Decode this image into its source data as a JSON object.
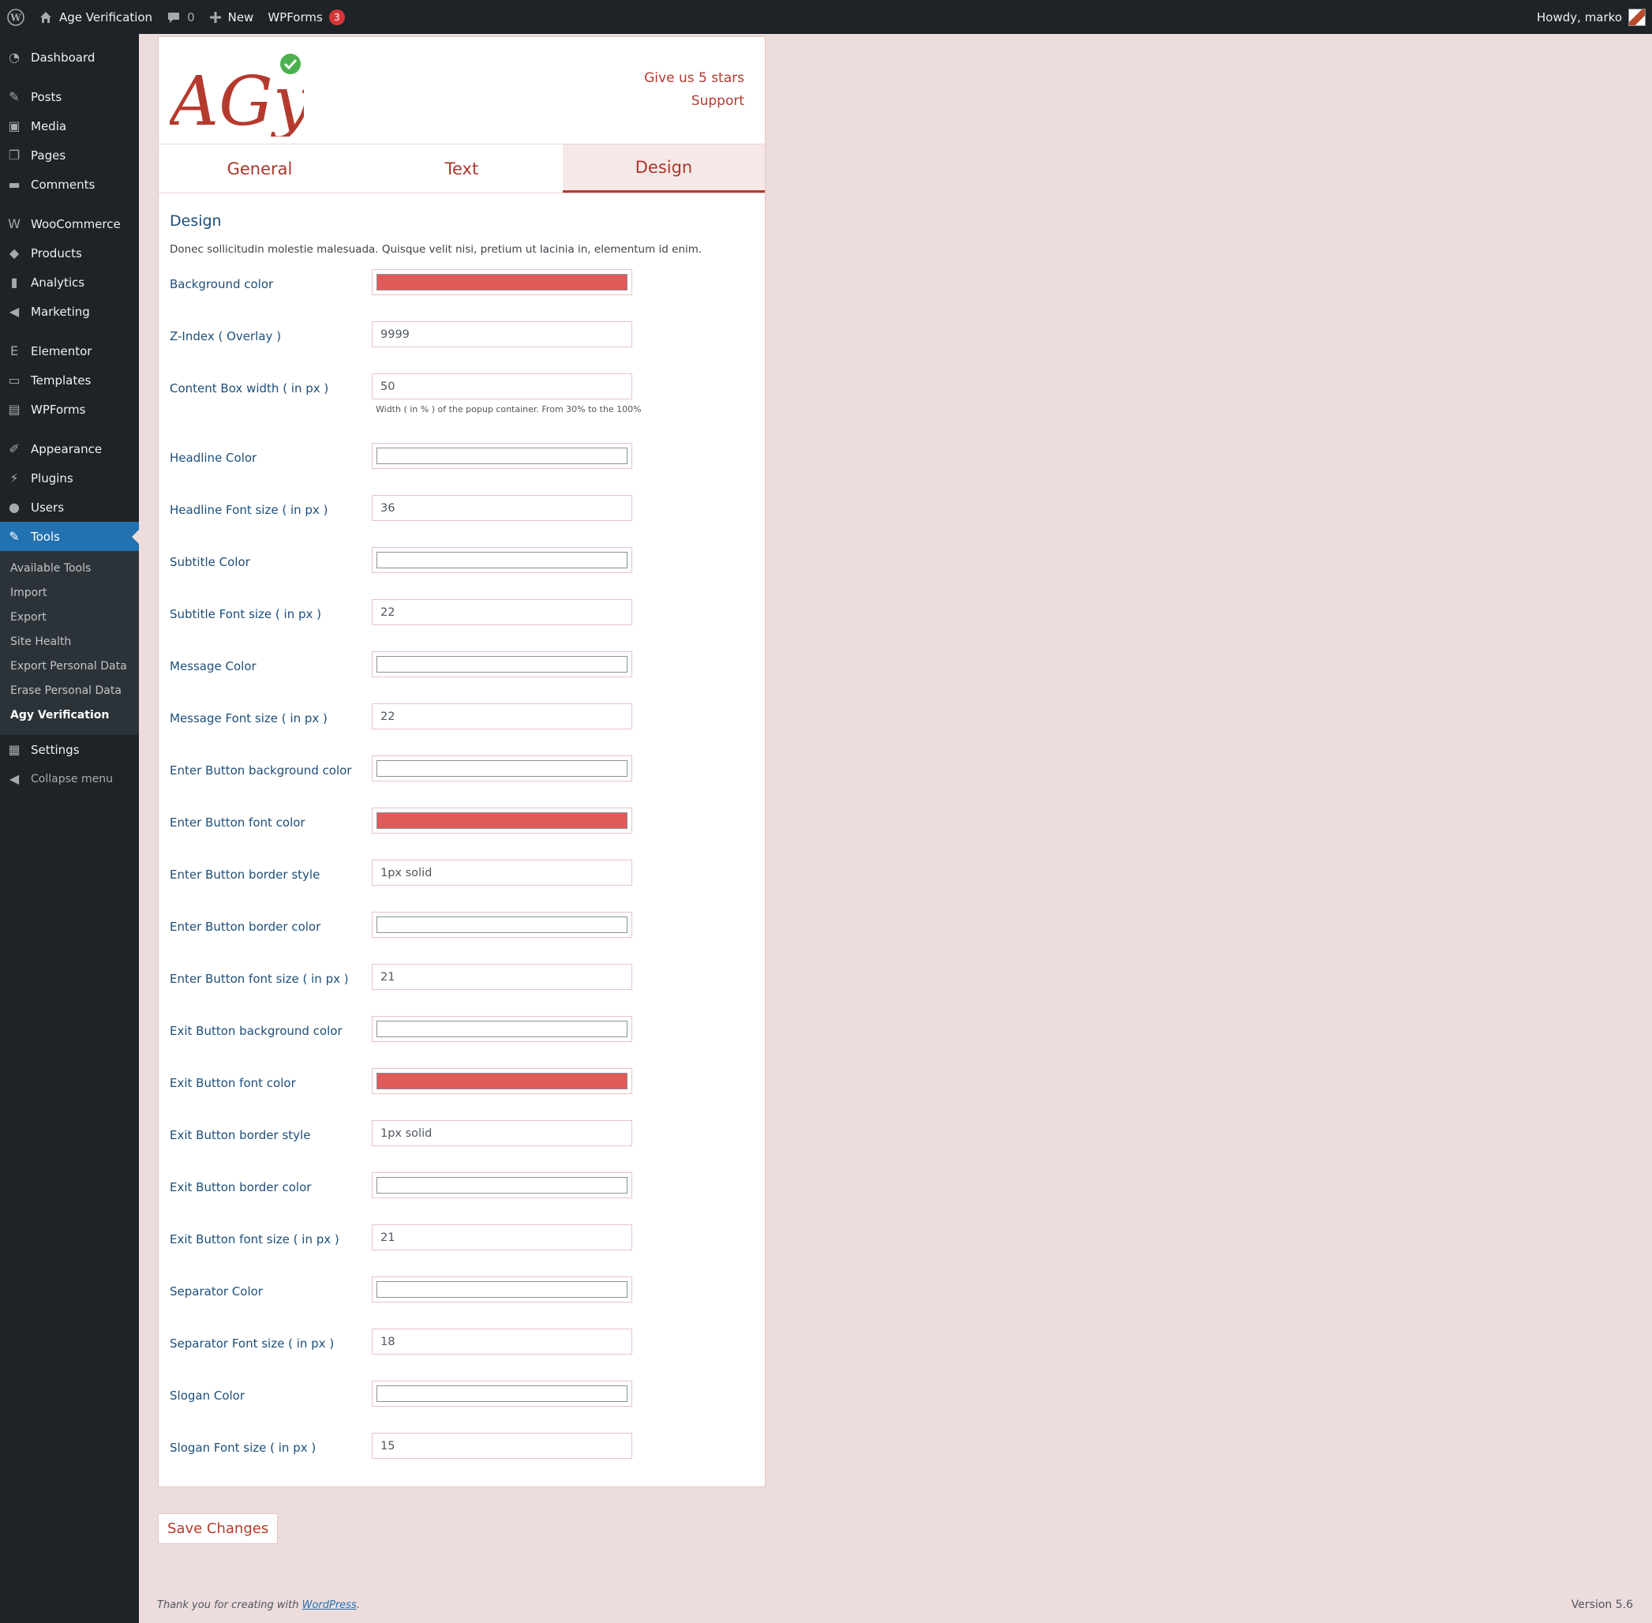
{
  "admin_bar": {
    "site_name": "Age Verification",
    "comments_count": "0",
    "new_label": "New",
    "wpforms_label": "WPForms",
    "wpforms_badge": "3",
    "howdy": "Howdy, marko"
  },
  "sidebar": {
    "items": [
      {
        "label": "Dashboard",
        "icon": "dashboard-icon"
      },
      {
        "label": "Posts",
        "icon": "pin-icon"
      },
      {
        "label": "Media",
        "icon": "media-icon"
      },
      {
        "label": "Pages",
        "icon": "pages-icon"
      },
      {
        "label": "Comments",
        "icon": "comment-icon"
      },
      {
        "label": "WooCommerce",
        "icon": "woo-icon"
      },
      {
        "label": "Products",
        "icon": "box-icon"
      },
      {
        "label": "Analytics",
        "icon": "bar-chart-icon"
      },
      {
        "label": "Marketing",
        "icon": "megaphone-icon"
      },
      {
        "label": "Elementor",
        "icon": "elementor-icon"
      },
      {
        "label": "Templates",
        "icon": "folder-icon"
      },
      {
        "label": "WPForms",
        "icon": "form-icon"
      },
      {
        "label": "Appearance",
        "icon": "brush-icon"
      },
      {
        "label": "Plugins",
        "icon": "plug-icon"
      },
      {
        "label": "Users",
        "icon": "user-icon"
      },
      {
        "label": "Tools",
        "icon": "wrench-icon"
      }
    ],
    "submenu": [
      "Available Tools",
      "Import",
      "Export",
      "Site Health",
      "Export Personal Data",
      "Erase Personal Data",
      "Agy Verification"
    ],
    "settings": "Settings",
    "collapse": "Collapse menu"
  },
  "header": {
    "logo_text": "AGy",
    "link_stars": "Give us 5 stars",
    "link_support": "Support"
  },
  "tabs": [
    "General",
    "Text",
    "Design"
  ],
  "section": {
    "title": "Design",
    "description": "Donec sollicitudin molestie malesuada. Quisque velit nisi, pretium ut lacinia in, elementum id enim."
  },
  "fields": [
    {
      "label": "Background color",
      "type": "color",
      "value": "#e05a5a"
    },
    {
      "label": "Z-Index ( Overlay )",
      "type": "text",
      "value": "9999"
    },
    {
      "label": "Content Box width ( in px )",
      "type": "text",
      "value": "50",
      "hint": "Width ( in % ) of the popup container. From 30% to the 100%"
    },
    {
      "label": "Headline Color",
      "type": "color",
      "value": "#ffffff"
    },
    {
      "label": "Headline Font size ( in px )",
      "type": "text",
      "value": "36"
    },
    {
      "label": "Subtitle Color",
      "type": "color",
      "value": "#ffffff"
    },
    {
      "label": "Subtitle Font size ( in px )",
      "type": "text",
      "value": "22"
    },
    {
      "label": "Message Color",
      "type": "color",
      "value": "#ffffff"
    },
    {
      "label": "Message Font size ( in px )",
      "type": "text",
      "value": "22"
    },
    {
      "label": "Enter Button background color",
      "type": "color",
      "value": "#ffffff"
    },
    {
      "label": "Enter Button font color",
      "type": "color",
      "value": "#e05a5a"
    },
    {
      "label": "Enter Button border style",
      "type": "text",
      "value": "1px solid"
    },
    {
      "label": "Enter Button border color",
      "type": "color",
      "value": "#ffffff"
    },
    {
      "label": "Enter Button font size ( in px )",
      "type": "text",
      "value": "21"
    },
    {
      "label": "Exit Button background color",
      "type": "color",
      "value": "#ffffff"
    },
    {
      "label": "Exit Button font color",
      "type": "color",
      "value": "#e05a5a"
    },
    {
      "label": "Exit Button border style",
      "type": "text",
      "value": "1px solid"
    },
    {
      "label": "Exit Button border color",
      "type": "color",
      "value": "#ffffff"
    },
    {
      "label": "Exit Button font size ( in px )",
      "type": "text",
      "value": "21"
    },
    {
      "label": "Separator Color",
      "type": "color",
      "value": "#ffffff"
    },
    {
      "label": "Separator Font size ( in px )",
      "type": "text",
      "value": "18"
    },
    {
      "label": "Slogan Color",
      "type": "color",
      "value": "#ffffff"
    },
    {
      "label": "Slogan Font size ( in px )",
      "type": "text",
      "value": "15"
    }
  ],
  "save_label": "Save Changes",
  "footer": {
    "thanks": "Thank you for creating with",
    "link": "WordPress",
    "version": "Version 5.6"
  },
  "colors": {
    "accent": "#b53a2e",
    "label": "#1d4e79",
    "admin_dark": "#1d2327",
    "active_blue": "#2271b1",
    "background": "#ecdcdc"
  }
}
